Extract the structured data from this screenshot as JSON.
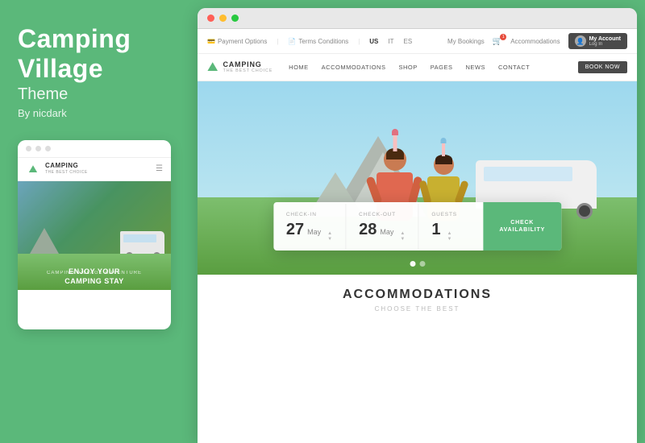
{
  "left": {
    "title": "Camping Village",
    "subtitle": "Theme",
    "author": "By nicdark"
  },
  "mobile": {
    "logo": "CAMPING",
    "logo_sub": "THE BEST CHOICE",
    "tagline": "CAMPING VILLAGE ADVENTURE",
    "headline_line1": "ENJOY YOUR",
    "headline_line2": "CAMPING STAY"
  },
  "browser": {
    "dots": [
      "red",
      "yellow",
      "green"
    ]
  },
  "utility_bar": {
    "payment_options": "Payment Options",
    "terms": "Terms Conditions",
    "lang_us": "US",
    "lang_it": "IT",
    "lang_es": "ES",
    "my_bookings": "My Bookings",
    "accommodations": "Accommodations",
    "account_label": "My Account",
    "account_sub": "Log In"
  },
  "nav": {
    "logo": "CAMPING",
    "logo_sub": "THE BEST CHOICE",
    "links": [
      {
        "label": "HOME",
        "active": false
      },
      {
        "label": "ACCOMMODATIONS",
        "active": false
      },
      {
        "label": "SHOP",
        "active": false
      },
      {
        "label": "PAGES",
        "active": false
      },
      {
        "label": "NEWS",
        "active": false
      },
      {
        "label": "CONTACT",
        "active": false
      }
    ],
    "book_btn": "BOOK NOW"
  },
  "booking": {
    "checkin_label": "CHECK-IN",
    "checkin_day": "27",
    "checkin_month": "May",
    "checkout_label": "CHECK-OUT",
    "checkout_day": "28",
    "checkout_month": "May",
    "guests_label": "GUESTS",
    "guests_count": "1",
    "cta_line1": "CHECK",
    "cta_line2": "AVAILABILITY"
  },
  "section": {
    "title": "ACCOMMODATIONS",
    "subtitle": "CHOOSE THE BEST"
  },
  "colors": {
    "brand_green": "#5bb87a",
    "dark": "#4a4a4a",
    "book_btn": "#4a4a4a"
  }
}
